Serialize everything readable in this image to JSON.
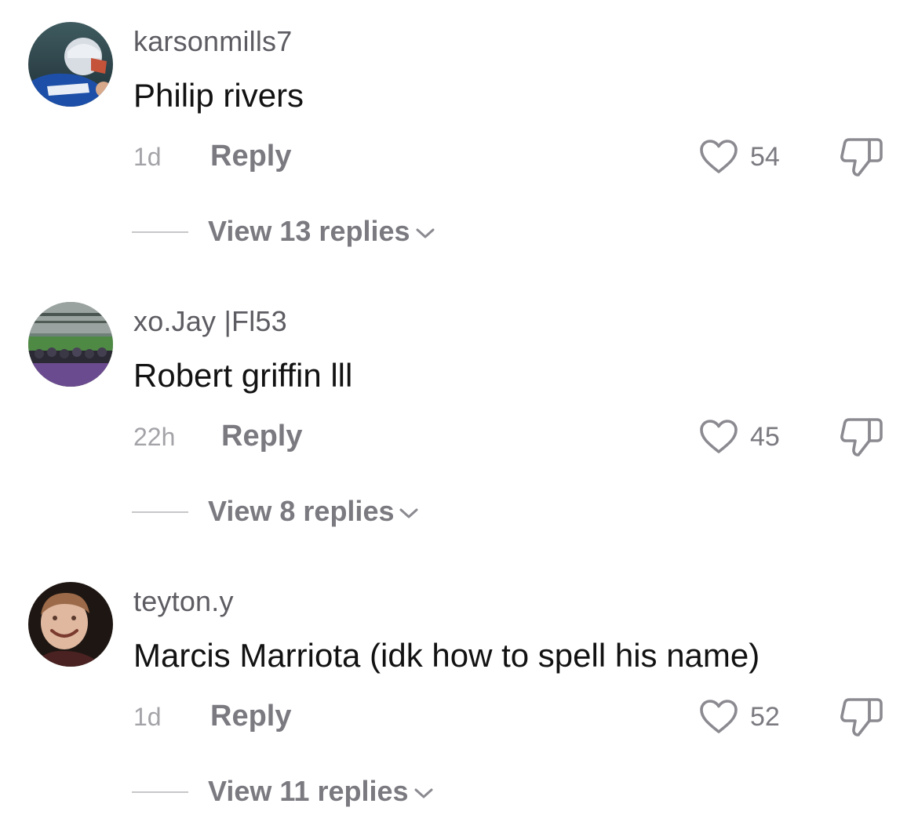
{
  "comments": [
    {
      "username": "karsonmills7",
      "text": "Philip rivers",
      "time": "1d",
      "reply_label": "Reply",
      "likes": "54",
      "view_replies": "View 13 replies",
      "avatar": "football-player-avatar"
    },
    {
      "username": "xo.Jay |Fl53",
      "text": "Robert griffin lll",
      "time": "22h",
      "reply_label": "Reply",
      "likes": "45",
      "view_replies": "View 8 replies",
      "avatar": "stadium-team-avatar"
    },
    {
      "username": "teyton.y",
      "text": "Marcis Marriota (idk how to spell his name)",
      "time": "1d",
      "reply_label": "Reply",
      "likes": "52",
      "view_replies": "View 11 replies",
      "avatar": "smiling-kid-avatar"
    }
  ],
  "icons": {
    "like": "heart-outline-icon",
    "dislike": "thumbs-down-outline-icon",
    "expand": "chevron-down-icon"
  },
  "colors": {
    "username": "#5c5c62",
    "text": "#121212",
    "meta": "#a3a3a8",
    "action": "#7a7a80",
    "divider": "#c7c7cb"
  }
}
